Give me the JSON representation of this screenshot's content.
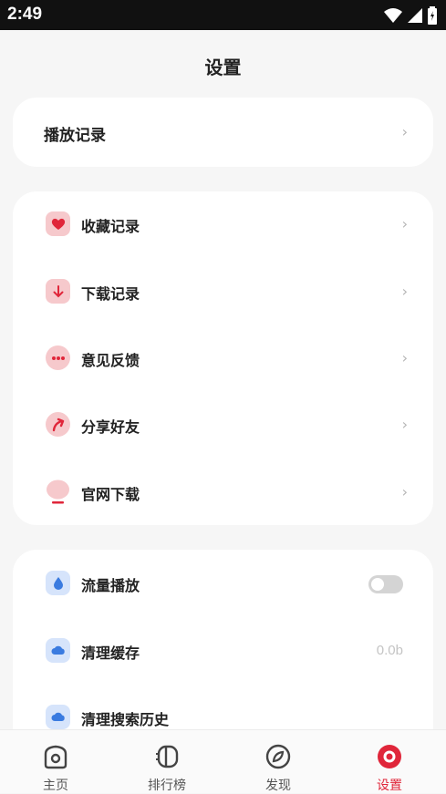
{
  "status_bar": {
    "time": "2:49"
  },
  "page_title": "设置",
  "card1": {
    "items": [
      {
        "label": "播放记录"
      }
    ]
  },
  "card2": {
    "items": [
      {
        "label": "收藏记录",
        "icon": "heart-icon"
      },
      {
        "label": "下载记录",
        "icon": "download-arrow-icon"
      },
      {
        "label": "意见反馈",
        "icon": "chat-bubble-icon"
      },
      {
        "label": "分享好友",
        "icon": "share-arrow-icon"
      },
      {
        "label": "官网下载",
        "icon": "website-icon"
      }
    ]
  },
  "card3": {
    "items": [
      {
        "label": "流量播放",
        "icon": "water-drop-icon",
        "toggle": false
      },
      {
        "label": "清理缓存",
        "icon": "cloud-icon",
        "value": "0.0b"
      },
      {
        "label": "清理搜索历史",
        "icon": "cloud-icon"
      }
    ]
  },
  "chevron": "›",
  "tabbar": {
    "tabs": [
      {
        "label": "主页",
        "icon": "home-icon"
      },
      {
        "label": "排行榜",
        "icon": "rank-icon"
      },
      {
        "label": "发现",
        "icon": "discover-compass-icon"
      },
      {
        "label": "设置",
        "icon": "settings-icon",
        "active": true
      }
    ]
  },
  "colors": {
    "accent": "#e0263a",
    "pink_icon_bg": "#f6c9cc",
    "blue_icon_bg": "#d6e4fb",
    "blue_icon": "#3a7be0"
  }
}
